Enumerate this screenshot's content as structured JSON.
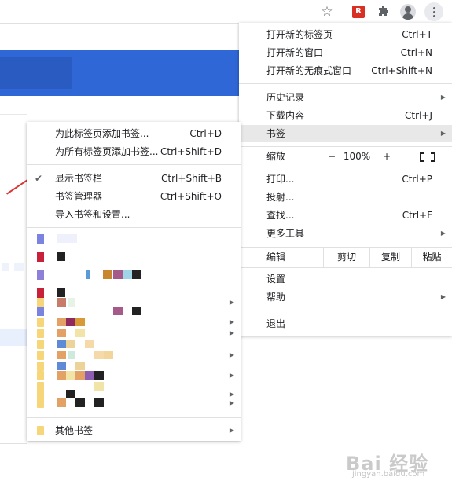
{
  "toolbar": {
    "icons": [
      "star-icon",
      "extension-icon",
      "puzzle-icon",
      "profile-icon",
      "kebab-menu-icon"
    ],
    "ext_letter": "R"
  },
  "main_menu": {
    "new_tab": {
      "label": "打开新的标签页",
      "shortcut": "Ctrl+T"
    },
    "new_window": {
      "label": "打开新的窗口",
      "shortcut": "Ctrl+N"
    },
    "new_incognito": {
      "label": "打开新的无痕式窗口",
      "shortcut": "Ctrl+Shift+N"
    },
    "history": {
      "label": "历史记录"
    },
    "downloads": {
      "label": "下载内容",
      "shortcut": "Ctrl+J"
    },
    "bookmarks": {
      "label": "书签"
    },
    "zoom": {
      "label": "缩放",
      "minus": "−",
      "value": "100%",
      "plus": "+"
    },
    "print": {
      "label": "打印...",
      "shortcut": "Ctrl+P"
    },
    "cast": {
      "label": "投射..."
    },
    "find": {
      "label": "查找...",
      "shortcut": "Ctrl+F"
    },
    "more_tools": {
      "label": "更多工具"
    },
    "edit": {
      "label": "编辑",
      "cut": "剪切",
      "copy": "复制",
      "paste": "粘贴"
    },
    "settings": {
      "label": "设置"
    },
    "help": {
      "label": "帮助"
    },
    "exit": {
      "label": "退出"
    }
  },
  "bookmark_menu": {
    "add_this": {
      "label": "为此标签页添加书签...",
      "shortcut": "Ctrl+D"
    },
    "add_all": {
      "label": "为所有标签页添加书签...",
      "shortcut": "Ctrl+Shift+D"
    },
    "show_bar": {
      "label": "显示书签栏",
      "shortcut": "Ctrl+Shift+B"
    },
    "manager": {
      "label": "书签管理器",
      "shortcut": "Ctrl+Shift+O"
    },
    "import": {
      "label": "导入书签和设置..."
    },
    "other": {
      "label": "其他书签"
    }
  },
  "watermark": {
    "text": "Bai 经验",
    "sub": "jingyan.baidu.com"
  },
  "colors": {
    "accent_blue": "#2f67d6",
    "highlight": "#e8e8e8",
    "annotation_red": "#dd3333"
  }
}
